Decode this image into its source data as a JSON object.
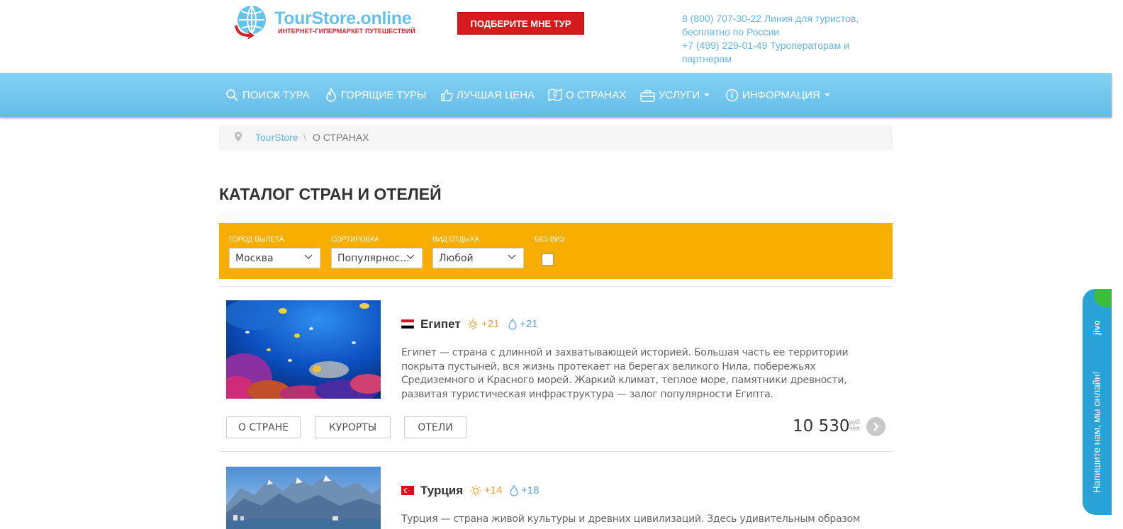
{
  "header": {
    "logo_text": "TourStore.online",
    "logo_subtitle": "ИНТЕРНЕТ-ГИПЕРМАРКЕТ ПУТЕШЕСТВИЙ",
    "pick_tour_button": "ПОДБЕРИТЕ МНЕ ТУР",
    "contact_line1": "8 (800) 707-30-22 Линия для туристов,",
    "contact_line2": "бесплатно по России",
    "contact_line3": "+7 (499) 229-01-49 Туроператорам и",
    "contact_line4": "партнерам"
  },
  "nav": {
    "items": [
      {
        "label": "ПОИСК ТУРА",
        "icon": "search-icon"
      },
      {
        "label": "ГОРЯЩИЕ ТУРЫ",
        "icon": "flame-icon"
      },
      {
        "label": "ЛУЧШАЯ ЦЕНА",
        "icon": "thumbs-up-icon"
      },
      {
        "label": "О СТРАНАХ",
        "icon": "map-pin-icon"
      },
      {
        "label": "УСЛУГИ",
        "icon": "suitcase-icon"
      },
      {
        "label": "ИНФОРМАЦИЯ",
        "icon": "info-icon"
      }
    ]
  },
  "breadcrumb": {
    "home": "TourStore",
    "separator": "\\",
    "current": "О СТРАНАХ"
  },
  "page": {
    "title": "КАТАЛОГ СТРАН И ОТЕЛЕЙ"
  },
  "filters": {
    "city_label": "ГОРОД ВЫЛЕТА",
    "city_value": "Москва",
    "sort_label": "СОРТИРОВКА",
    "sort_value": "Популярнос...",
    "type_label": "ВИД ОТДЫХА",
    "type_value": "Любой",
    "novisa_label": "БЕЗ ВИЗ",
    "novisa_checked": false
  },
  "countries": [
    {
      "name": "Египет",
      "air_temp": "+21",
      "water_temp": "+21",
      "description": "Египет — страна с длинной и захватывающей историей. Большая часть ее территории покрыта пустыней, вся жизнь протекает на берегах великого Нила, побережьях Средиземного и Красного морей. Жаркий климат, теплое море, памятники древности, развитая туристическая инфраструктура — залог популярности Египта.",
      "btn_about": "О СТРАНЕ",
      "btn_resorts": "КУРОРТЫ",
      "btn_hotels": "ОТЕЛИ",
      "price": "10 530",
      "price_unit1": "руб",
      "price_unit2": "чел"
    },
    {
      "name": "Турция",
      "air_temp": "+14",
      "water_temp": "+18",
      "description": "Турция — страна живой культуры и древних цивилизаций. Здесь удивительным образом"
    }
  ],
  "jivo": {
    "logo": "jivo",
    "text": "Напишите нам, мы онлайн!"
  },
  "colors": {
    "nav_blue": "#63bce7",
    "filter_orange": "#f7ae00",
    "pick_button_red": "#d51b1e",
    "link_blue": "#62b5e5",
    "jivo_blue": "#29a3d7"
  }
}
